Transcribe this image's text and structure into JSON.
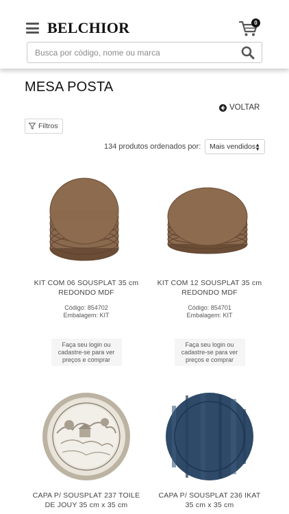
{
  "header": {
    "brand": "BELCHIOR",
    "cart_count": "0",
    "search_placeholder": "Busca por código, nome ou marca"
  },
  "page": {
    "title": "MESA POSTA",
    "back_label": "VOLTAR",
    "filter_label": "Filtros",
    "sort_prefix": "134 produtos ordenados por:",
    "sort_selected": "Mais vendidos"
  },
  "products": [
    {
      "name_line1": "KIT COM 06 SOUSPLAT 35 cm",
      "name_line2": "REDONDO MDF",
      "code": "Código: 854702",
      "packaging": "Embalagem: KIT",
      "login_line1": "Faça seu login ou",
      "login_line2": "cadastre-se para ver",
      "login_line3": "preços e comprar"
    },
    {
      "name_line1": "KIT COM 12 SOUSPLAT 35 cm",
      "name_line2": "REDONDO MDF",
      "code": "Código: 854701",
      "packaging": "Embalagem: KIT",
      "login_line1": "Faça seu login ou",
      "login_line2": "cadastre-se para ver",
      "login_line3": "preços e comprar"
    },
    {
      "name_line1": "CAPA P/ SOUSPLAT 237 TOILE",
      "name_line2": "DE JOUY 35 cm x 35 cm"
    },
    {
      "name_line1": "CAPA P/ SOUSPLAT 236 IKAT",
      "name_line2": "35 cm x 35 cm"
    }
  ],
  "icons": {
    "menu": "hamburger-menu-icon",
    "cart": "shopping-cart-icon",
    "search": "search-icon",
    "back": "arrow-left-circle-icon",
    "filter": "funnel-icon",
    "sort_caret": "up-down-caret-icon"
  },
  "colors": {
    "text_dark": "#111111",
    "mdf_brown": "#8a6a4e",
    "toile_beige": "#cfc6b8",
    "ikat_blue": "#2e4a68"
  }
}
